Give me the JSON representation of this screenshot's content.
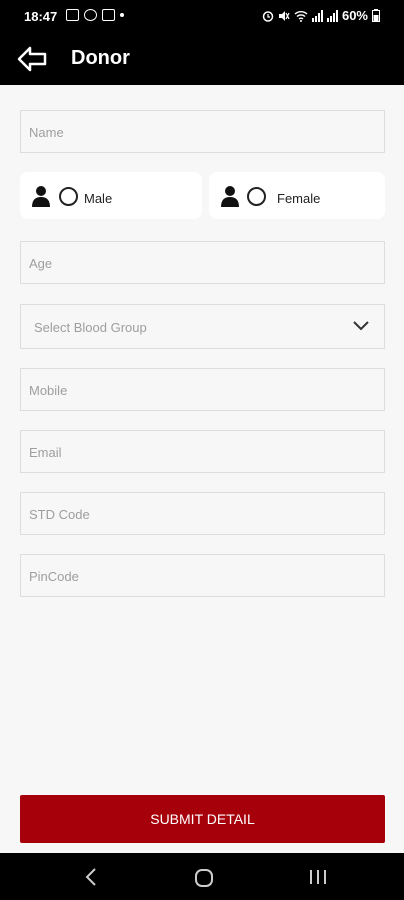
{
  "status_bar": {
    "time": "18:47",
    "battery": "60%"
  },
  "app_bar": {
    "title": "Donor"
  },
  "form": {
    "name_placeholder": "Name",
    "gender": {
      "male_label": "Male",
      "female_label": "Female"
    },
    "age_placeholder": "Age",
    "blood_group_placeholder": "Select Blood Group",
    "mobile_placeholder": "Mobile",
    "email_placeholder": "Email",
    "std_code_placeholder": "STD Code",
    "pincode_placeholder": "PinCode",
    "submit_label": "SUBMIT DETAIL"
  },
  "colors": {
    "accent": "#a6000b",
    "app_bar": "#000000",
    "background": "#f7f7f7"
  },
  "icons": [
    "back-arrow-icon",
    "person-icon",
    "radio-icon",
    "chevron-down-icon",
    "nav-back-icon",
    "nav-home-icon",
    "nav-recents-icon"
  ]
}
